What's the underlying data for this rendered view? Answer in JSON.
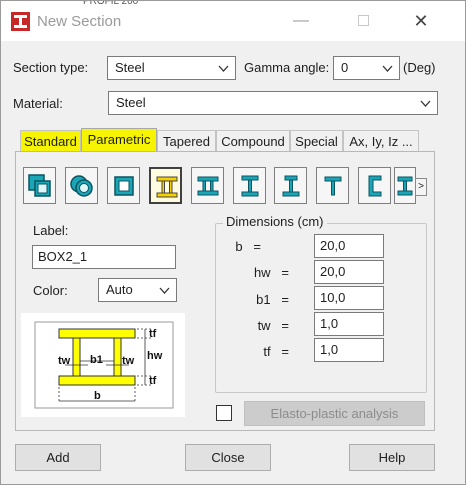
{
  "window": {
    "title": "New Section",
    "background_peek_text": "PROFIL 200"
  },
  "form": {
    "section_type_label": "Section type:",
    "section_type_value": "Steel",
    "gamma_label": "Gamma angle:",
    "gamma_value": "0",
    "gamma_unit": "(Deg)",
    "material_label": "Material:",
    "material_value": "Steel"
  },
  "tabs": [
    {
      "label": "Standard",
      "highlighted": true
    },
    {
      "label": "Parametric",
      "highlighted": true,
      "active": true
    },
    {
      "label": "Tapered"
    },
    {
      "label": "Compound"
    },
    {
      "label": "Special"
    },
    {
      "label": "Ax, Iy, Iz ..."
    }
  ],
  "section_shapes": [
    {
      "icon": "double-box-icon"
    },
    {
      "icon": "double-tube-icon"
    },
    {
      "icon": "box-icon"
    },
    {
      "icon": "i-beam-selected-icon",
      "active": true
    },
    {
      "icon": "i-beam-wide-icon"
    },
    {
      "icon": "i-beam-icon"
    },
    {
      "icon": "i-beam-narrow-icon"
    },
    {
      "icon": "t-section-icon"
    },
    {
      "icon": "channel-icon"
    },
    {
      "icon": "asymmetric-i-icon"
    }
  ],
  "left_panel": {
    "label_caption": "Label:",
    "label_value": "BOX2_1",
    "color_caption": "Color:",
    "color_value": "Auto"
  },
  "diagram_labels": {
    "tf_top": "tf",
    "hw": "hw",
    "tw_left": "tw",
    "b1": "b1",
    "tw_right": "tw",
    "tf_bottom": "tf",
    "b": "b"
  },
  "dimensions": {
    "title": "Dimensions (cm)",
    "rows": [
      {
        "name": "b",
        "eq": "=",
        "value": "20,0"
      },
      {
        "name": "hw",
        "eq": "=",
        "value": "20,0"
      },
      {
        "name": "b1",
        "eq": "=",
        "value": "10,0"
      },
      {
        "name": "tw",
        "eq": "=",
        "value": "1,0"
      },
      {
        "name": "tf",
        "eq": "=",
        "value": "1,0"
      }
    ]
  },
  "elasto_plastic_label": "Elasto-plastic analysis",
  "buttons": {
    "add": "Add",
    "close": "Close",
    "help": "Help"
  },
  "colors": {
    "highlight": "#f6f400",
    "section_fill": "#ffff00",
    "icon_teal": "#1aa6b7"
  }
}
